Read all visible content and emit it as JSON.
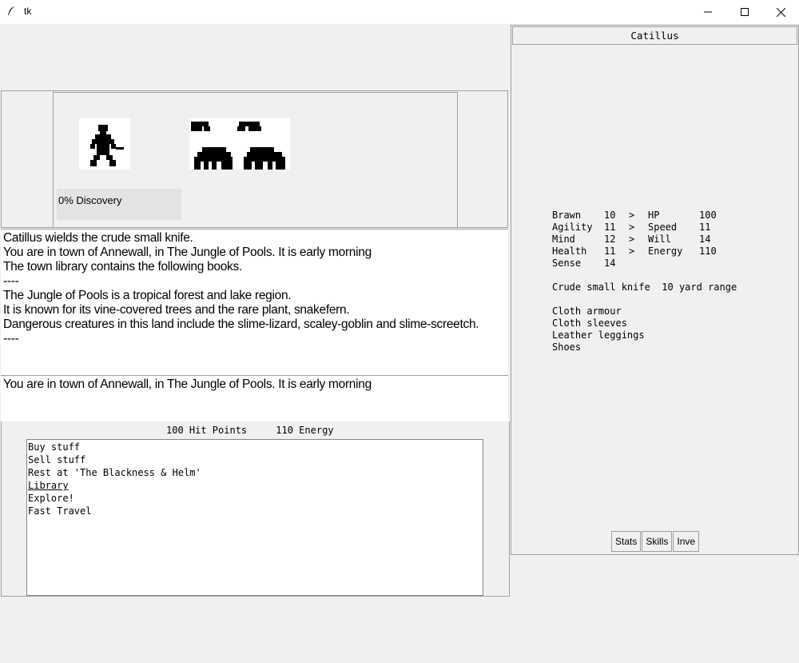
{
  "window": {
    "title": "tk"
  },
  "discovery": "0% Discovery",
  "message_log": [
    "Catillus wields the crude small knife.",
    "You are in town of Annewall, in The Jungle of Pools. It is early morning",
    "The town library contains the following books.",
    "----",
    "The Jungle of Pools is a tropical forest and lake region.",
    "It is known for its vine-covered trees and the rare plant, snakefern.",
    "Dangerous creatures in this land include the slime-lizard, scaley-goblin and slime-screetch.",
    "----"
  ],
  "location_text": "You are in town of Annewall, in The Jungle of Pools. It is early morning",
  "status": {
    "hp": "100 Hit Points",
    "energy": "110 Energy"
  },
  "actions": [
    "Buy stuff",
    "Sell stuff",
    "Rest at 'The Blackness & Helm'",
    "Library",
    "Explore!",
    "Fast Travel"
  ],
  "character": {
    "name": "Catillus",
    "stats": [
      {
        "name": "Brawn",
        "value": "10",
        "arrow": ">",
        "derived": "HP",
        "derived_value": "100"
      },
      {
        "name": "Agility",
        "value": "11",
        "arrow": ">",
        "derived": "Speed",
        "derived_value": "11"
      },
      {
        "name": "Mind",
        "value": "12",
        "arrow": ">",
        "derived": "Will",
        "derived_value": "14"
      },
      {
        "name": "Health",
        "value": "11",
        "arrow": ">",
        "derived": "Energy",
        "derived_value": "110"
      },
      {
        "name": "Sense",
        "value": "14",
        "arrow": "",
        "derived": "",
        "derived_value": ""
      }
    ],
    "weapon": "Crude small knife",
    "weapon_range": "10 yard range",
    "armour": [
      "Cloth armour",
      "Cloth sleeves",
      "Leather leggings",
      "Shoes"
    ]
  },
  "tabs": [
    "Stats",
    "Skills",
    "Inve"
  ]
}
